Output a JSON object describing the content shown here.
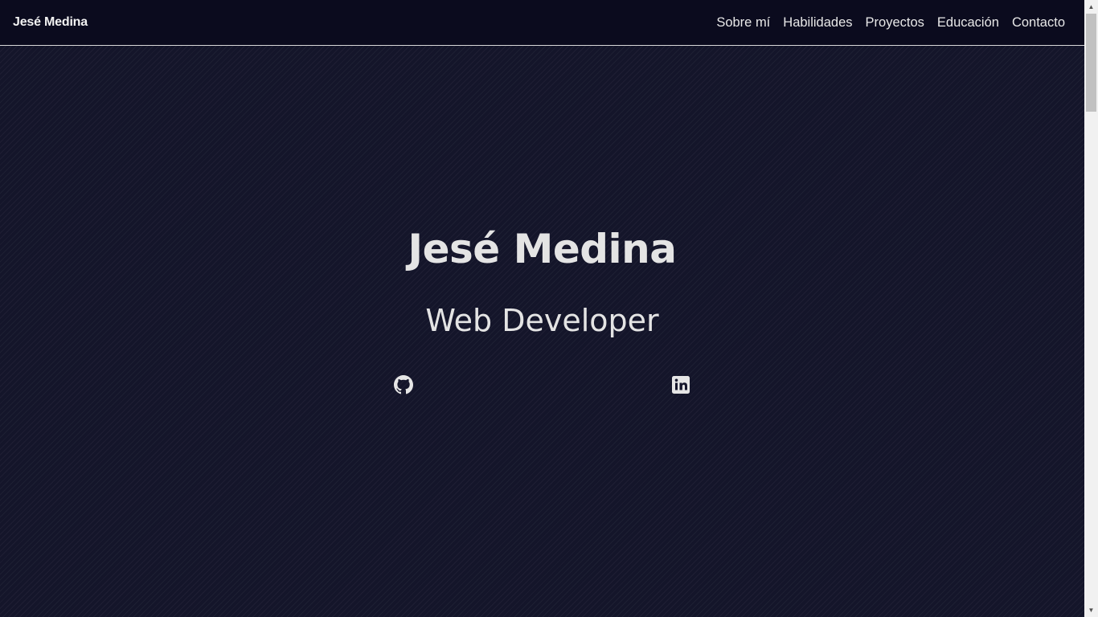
{
  "navbar": {
    "brand": "Jesé Medina",
    "links": [
      "Sobre mí",
      "Habilidades",
      "Proyectos",
      "Educación",
      "Contacto"
    ]
  },
  "hero": {
    "name": "Jesé Medina",
    "role": "Web Developer",
    "social": [
      {
        "icon": "github-icon"
      },
      {
        "icon": "linkedin-icon"
      }
    ]
  },
  "colors": {
    "background": "#14152a",
    "navbar": "#0b0b1e",
    "text": "#e4e4e4"
  }
}
